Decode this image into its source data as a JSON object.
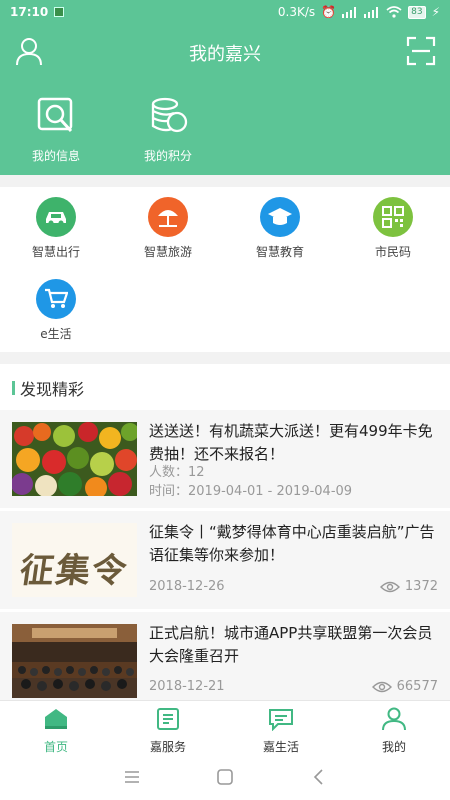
{
  "status": {
    "time": "17:10",
    "speed": "0.3K/s",
    "battery": "83"
  },
  "header": {
    "title": "我的嘉兴",
    "quick": [
      {
        "label": "我的信息",
        "icon": "profile-search-icon"
      },
      {
        "label": "我的积分",
        "icon": "coins-icon"
      }
    ]
  },
  "services": [
    {
      "label": "智慧出行",
      "icon": "car-icon",
      "color": "#3eb36b"
    },
    {
      "label": "智慧旅游",
      "icon": "beach-umbrella-icon",
      "color": "#f0642a"
    },
    {
      "label": "智慧教育",
      "icon": "graduation-cap-icon",
      "color": "#1f97e6"
    },
    {
      "label": "市民码",
      "icon": "qr-code-icon",
      "color": "#7dc23f"
    },
    {
      "label": "e生活",
      "icon": "shopping-cart-icon",
      "color": "#1f97e6"
    }
  ],
  "discover": {
    "title": "发现精彩",
    "items": [
      {
        "title": "送送送！有机蔬菜大派送！更有499年卡免费抽！还不来报名！",
        "count": "人数：12",
        "time": "时间：2019-04-01 - 2019-04-09"
      },
      {
        "title": "征集令丨“戴梦得体育中心店重装启航”广告语征集等你来参加！",
        "date": "2018-12-26",
        "views": "1372",
        "thumb_text": "征集令"
      },
      {
        "title": "正式启航！城市通APP共享联盟第一次会员大会隆重召开",
        "date": "2018-12-21",
        "views": "66577"
      }
    ]
  },
  "tabbar": [
    {
      "label": "首页",
      "active": true
    },
    {
      "label": "嘉服务"
    },
    {
      "label": "嘉生活"
    },
    {
      "label": "我的"
    }
  ],
  "accent": "#5cc596"
}
